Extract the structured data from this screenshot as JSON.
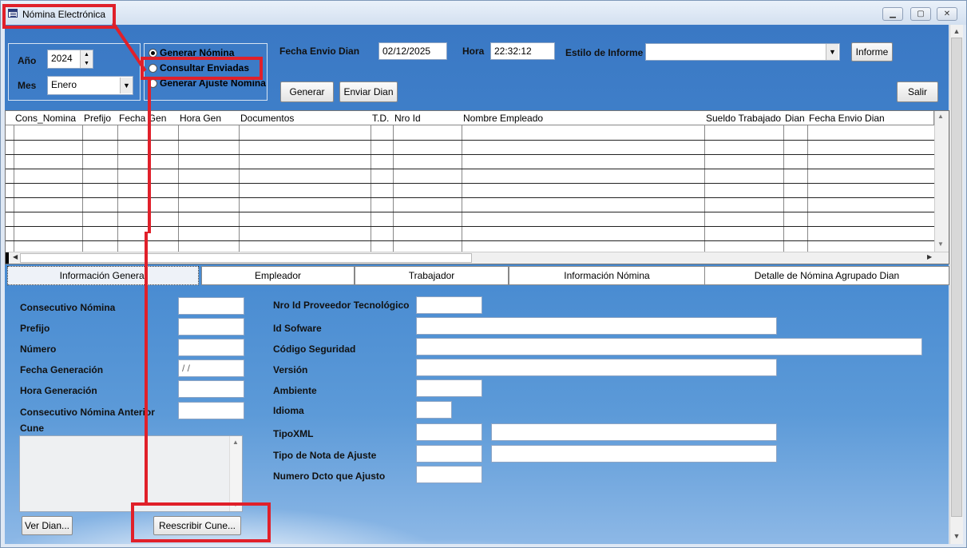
{
  "window": {
    "title": "Nómina Electrónica",
    "controls": {
      "minimize": "▁",
      "maximize": "▢",
      "close": "✕"
    }
  },
  "filters": {
    "anio_label": "Año",
    "anio_value": "2024",
    "mes_label": "Mes",
    "mes_value": "Enero"
  },
  "modes": [
    {
      "label": "Generar Nómina",
      "selected": true
    },
    {
      "label": "Consultar Enviadas",
      "selected": false
    },
    {
      "label": "Generar Ajuste Nomina",
      "selected": false
    }
  ],
  "header": {
    "fecha_envio_label": "Fecha Envio Dian",
    "fecha_envio_value": "02/12/2025",
    "hora_label": "Hora",
    "hora_value": "22:32:12",
    "estilo_label": "Estilo de Informe",
    "estilo_value": "",
    "informe_button": "Informe",
    "generar_button": "Generar",
    "enviar_button": "Enviar Dian",
    "salir_button": "Salir"
  },
  "grid": {
    "columns": [
      "Cons_Nomina",
      "Prefijo",
      "Fecha Gen",
      "Hora Gen",
      "Documentos",
      "T.D.",
      "Nro Id",
      "Nombre Empleado",
      "Sueldo Trabajado",
      "Dian",
      "Fecha Envio Dian"
    ]
  },
  "tabs": [
    "Información General",
    "Empleador",
    "Trabajador",
    "Información Nómina",
    "Detalle de Nómina Agrupado Dian"
  ],
  "left_form": {
    "consecutivo_label": "Consecutivo Nómina",
    "prefijo_label": "Prefijo",
    "numero_label": "Número",
    "fecha_gen_label": "Fecha Generación",
    "fecha_gen_value": " / /",
    "hora_gen_label": "Hora Generación",
    "consec_anterior_label": "Consecutivo Nómina Anterior",
    "cune_label": "Cune",
    "ver_dian_button": "Ver Dian...",
    "reescribir_button": "Reescribir Cune..."
  },
  "right_form": {
    "nro_id_label": "Nro Id Proveedor Tecnológico",
    "id_software_label": "Id Sofware",
    "codigo_label": "Código Seguridad",
    "version_label": "Versión",
    "ambiente_label": "Ambiente",
    "idioma_label": "Idioma",
    "tipoxml_label": "TipoXML",
    "tipo_nota_label": "Tipo de Nota de Ajuste",
    "numero_dcto_label": "Numero Dcto que Ajusto"
  },
  "colors": {
    "annotation": "#e0202a",
    "sky": "#4689d0"
  }
}
